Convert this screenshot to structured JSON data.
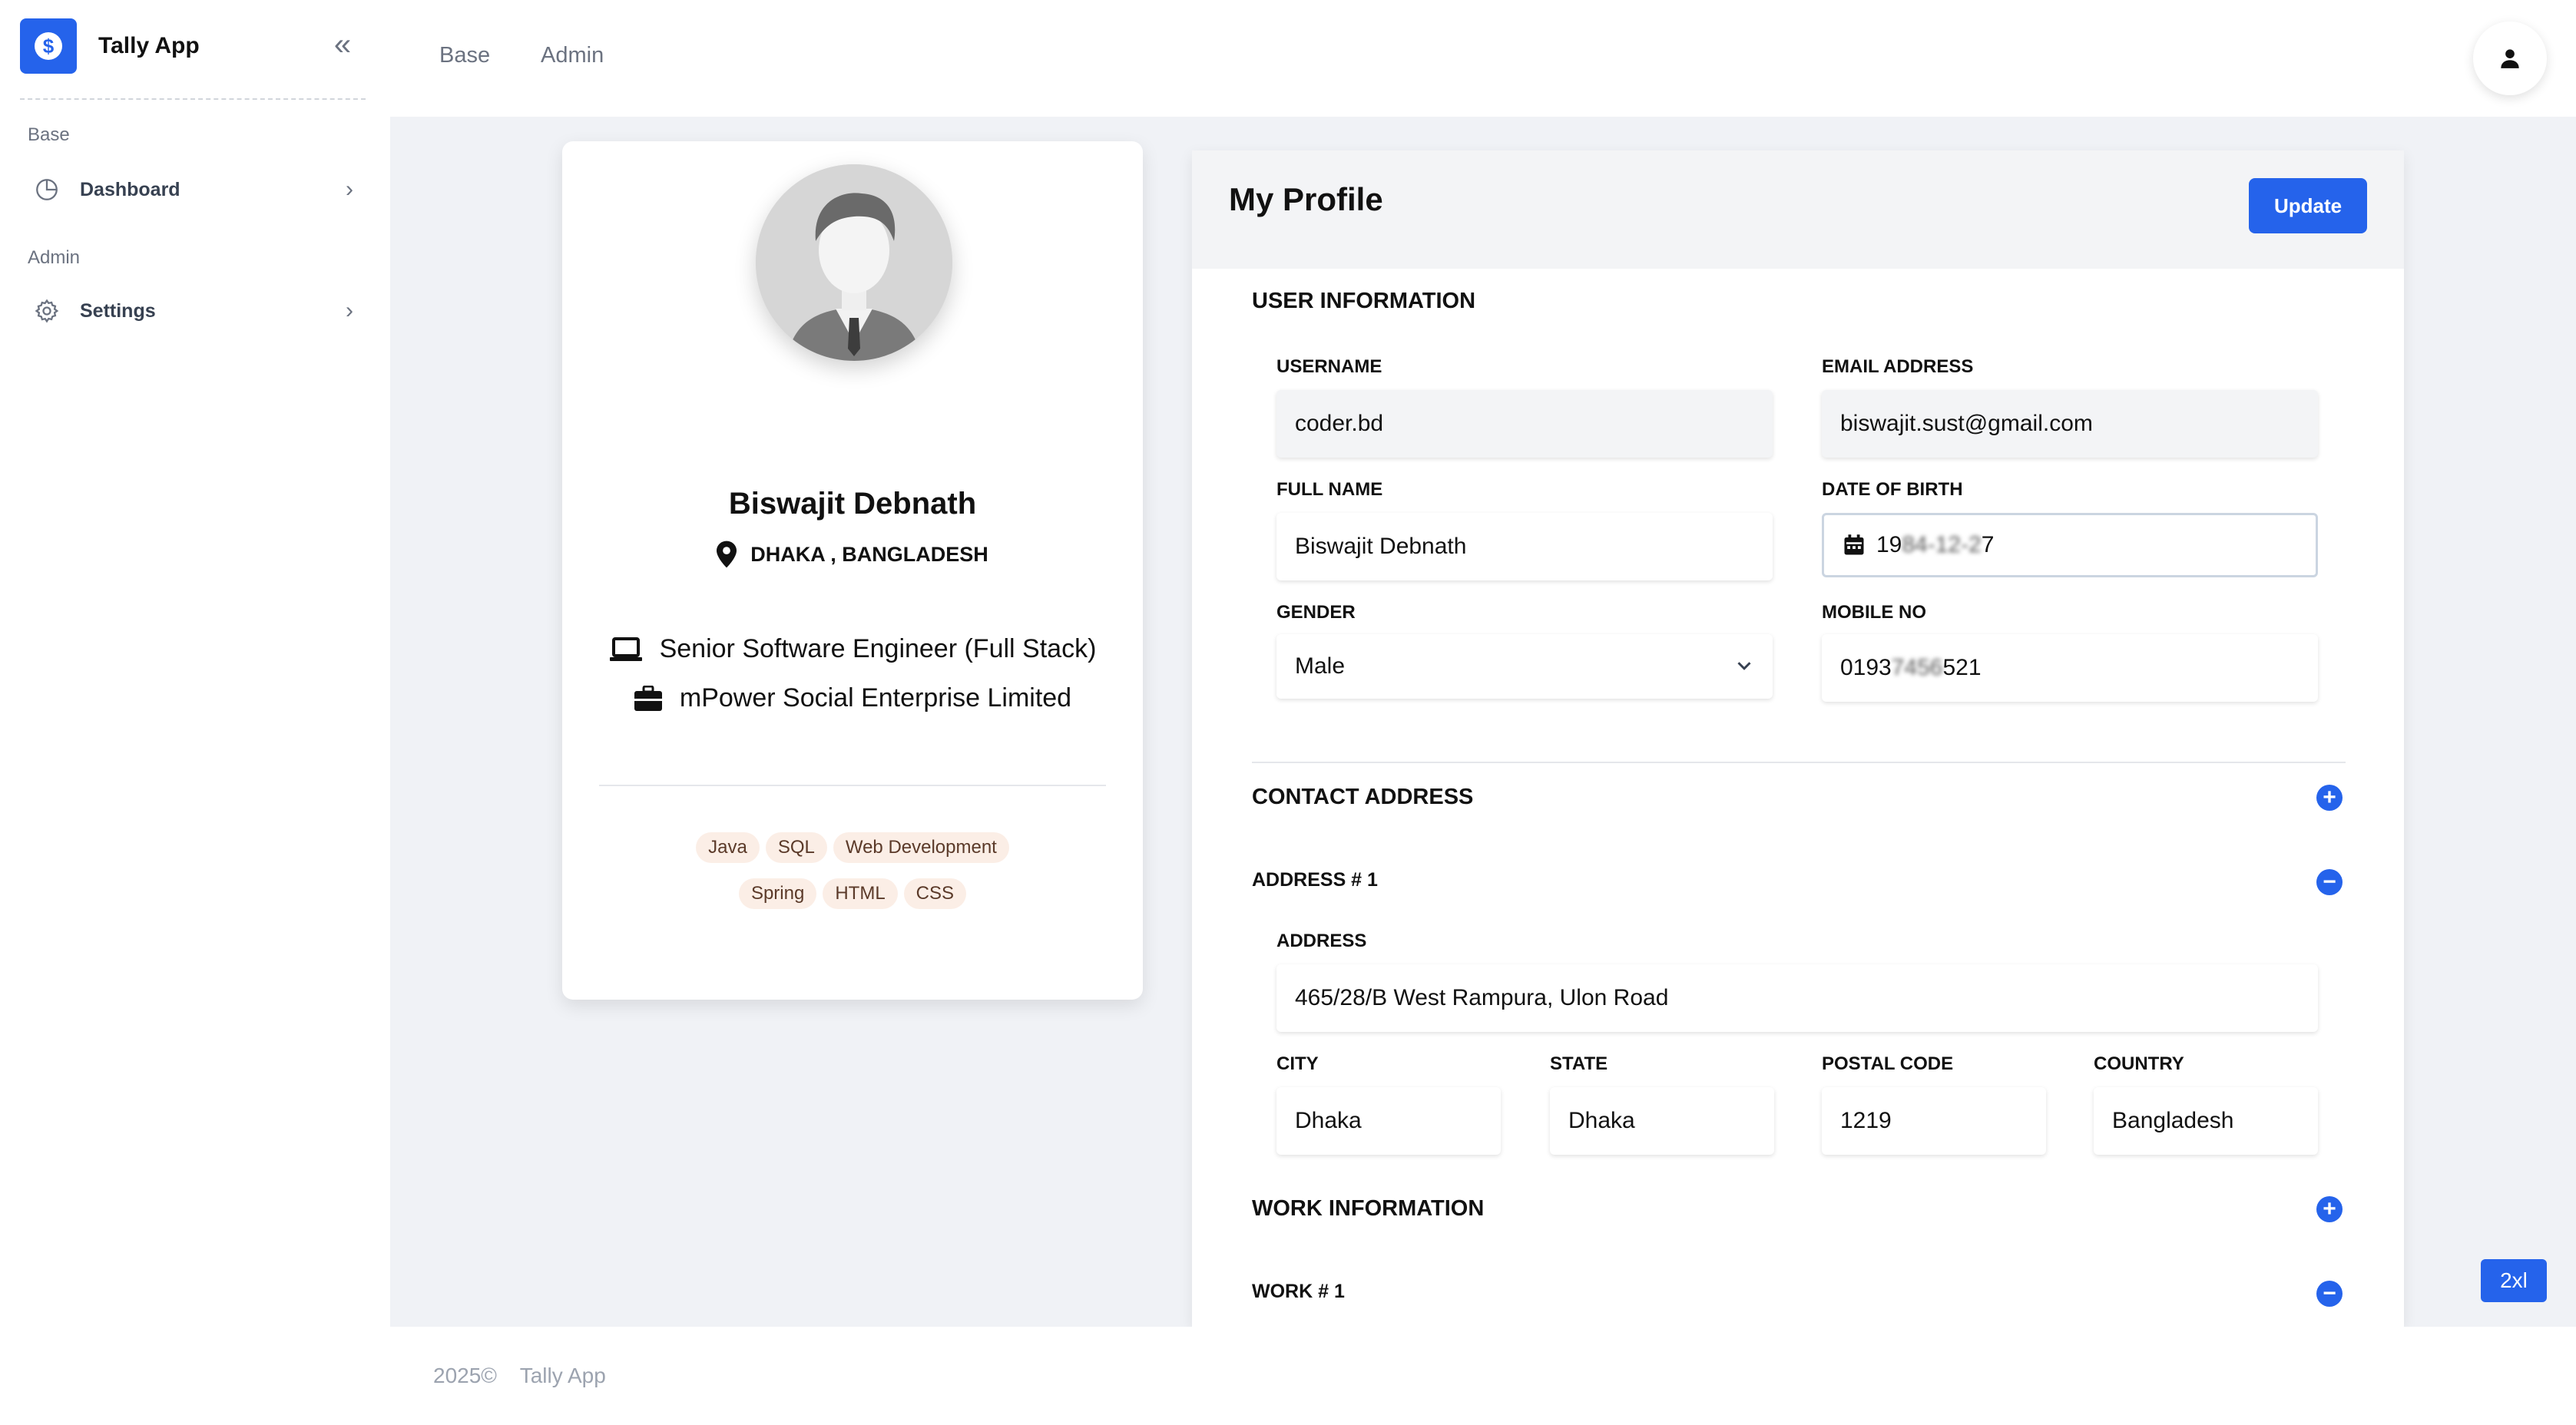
{
  "app": {
    "name": "Tally App"
  },
  "sidebar": {
    "sections": [
      {
        "title": "Base",
        "items": [
          {
            "label": "Dashboard",
            "icon": "pie-chart-icon"
          }
        ]
      },
      {
        "title": "Admin",
        "items": [
          {
            "label": "Settings",
            "icon": "gear-icon"
          }
        ]
      }
    ]
  },
  "topbar": {
    "links": [
      "Base",
      "Admin"
    ]
  },
  "profile": {
    "name": "Biswajit Debnath",
    "location": "DHAKA , BANGLADESH",
    "title": "Senior Software Engineer (Full Stack)",
    "company": "mPower Social Enterprise Limited",
    "skills_row1": [
      "Java",
      "SQL",
      "Web Development"
    ],
    "skills_row2": [
      "Spring",
      "HTML",
      "CSS"
    ]
  },
  "form": {
    "title": "My Profile",
    "update_label": "Update",
    "user_info": {
      "section_title": "USER INFORMATION",
      "username_label": "USERNAME",
      "username_value": "coder.bd",
      "email_label": "EMAIL ADDRESS",
      "email_value": "biswajit.sust@gmail.com",
      "fullname_label": "FULL NAME",
      "fullname_value": "Biswajit Debnath",
      "dob_label": "DATE OF BIRTH",
      "dob_prefix": "19",
      "dob_hidden": "84-12-2",
      "dob_suffix": "7",
      "gender_label": "GENDER",
      "gender_value": "Male",
      "mobile_label": "MOBILE NO",
      "mobile_prefix": "0193",
      "mobile_hidden": "7456",
      "mobile_suffix": "521"
    },
    "contact": {
      "section_title": "CONTACT ADDRESS",
      "address_title": "ADDRESS # 1",
      "address_label": "ADDRESS",
      "address_value": "465/28/B West Rampura, Ulon Road",
      "city_label": "CITY",
      "city_value": "Dhaka",
      "state_label": "STATE",
      "state_value": "Dhaka",
      "postal_label": "POSTAL CODE",
      "postal_value": "1219",
      "country_label": "COUNTRY",
      "country_value": "Bangladesh"
    },
    "work": {
      "section_title": "WORK INFORMATION",
      "work_title": "WORK # 1"
    }
  },
  "footer": {
    "year": "2025©",
    "app": "Tally App"
  },
  "breakpoint": "2xl",
  "colors": {
    "primary": "#2563eb",
    "content_bg": "#f0f2f6",
    "tag_bg": "#fbeee6"
  }
}
